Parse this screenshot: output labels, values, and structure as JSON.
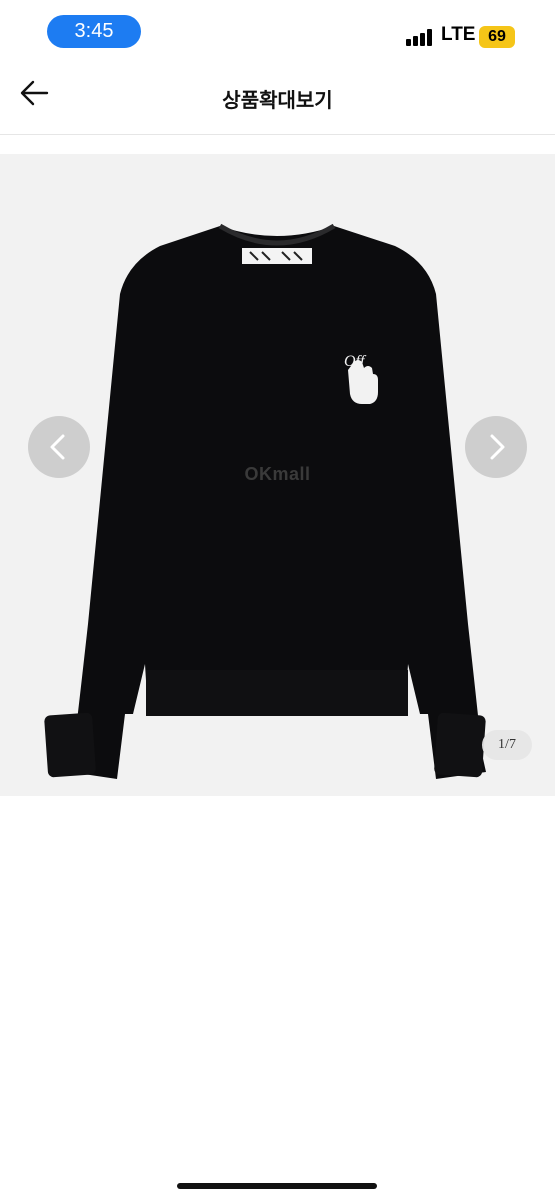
{
  "status_bar": {
    "time": "3:45",
    "network": "LTE",
    "battery": "69",
    "time_pill_color": "#1d7cf2",
    "battery_color": "#f5c518"
  },
  "header": {
    "title": "상품확대보기",
    "back_icon": "arrow-left-icon"
  },
  "gallery": {
    "watermark": "OKmall",
    "current": "1",
    "separator": "/",
    "total": "7",
    "prev_icon": "chevron-left-icon",
    "next_icon": "chevron-right-icon",
    "garment_color": "#0c0c0e",
    "logo_text": "Off"
  }
}
